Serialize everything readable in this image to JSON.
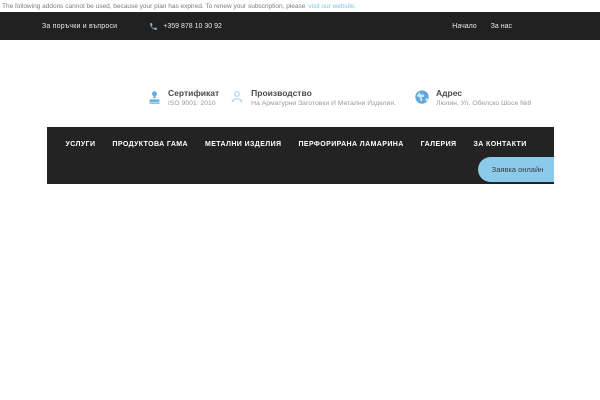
{
  "warning_bar": {
    "message": "The following addons cannot be used, because your plan has expired. To renew your subscription, please",
    "link_label": "visit our website",
    "suffix": "."
  },
  "topbar": {
    "orders_label": "За поръчки и въпроси",
    "phone": "+359 878 10 30 92",
    "menu": [
      {
        "label": "Начало"
      },
      {
        "label": "За нас"
      }
    ]
  },
  "features": [
    {
      "icon": "stamp-icon",
      "title": "Сертификат",
      "subtitle": "ISO 9001: 2010"
    },
    {
      "icon": "factory-icon",
      "title": "Производство",
      "subtitle": "На Арматурни Заготовки И Метални Изделия."
    },
    {
      "icon": "globe-icon",
      "title": "Адрес",
      "subtitle": "Люлин, Ул. Обелско Шосе №8"
    }
  ],
  "nav": {
    "items": [
      {
        "label": "УСЛУГИ"
      },
      {
        "label": "ПРОДУКТОВА ГАМА"
      },
      {
        "label": "МЕТАЛНИ ИЗДЕЛИЯ"
      },
      {
        "label": "ПЕРФОРИРАНА ЛАМАРИНА"
      },
      {
        "label": "ГАЛЕРИЯ"
      },
      {
        "label": "ЗА КОНТАКТИ"
      }
    ],
    "cta_label": "Заявка онлайн"
  },
  "colors": {
    "dark_bar": "#212121",
    "nav_bar": "#232323",
    "accent_blue": "#6db5e2",
    "button_blue": "#8ccaeb",
    "link_blue": "#7cc4e8"
  }
}
